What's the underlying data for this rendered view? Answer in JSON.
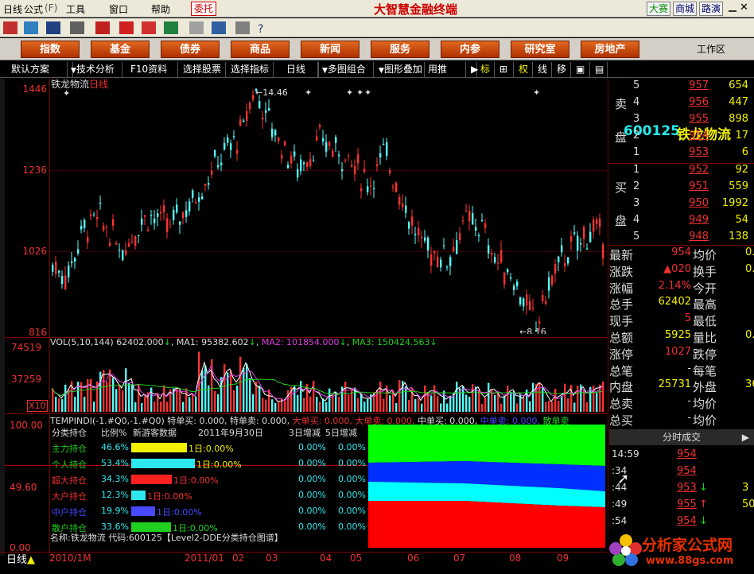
{
  "menu": {
    "items": [
      "日线",
      "公式",
      "工具",
      "窗口",
      "帮助"
    ],
    "weituo": "委托",
    "app_title": "大智慧金融终端",
    "right_btns": [
      "大赛",
      "商城",
      "路演"
    ]
  },
  "categories": [
    "指数",
    "基金",
    "债券",
    "商品",
    "新闻",
    "服务",
    "内参",
    "研究室",
    "房地产"
  ],
  "work_area": "工作区",
  "tabs": [
    "默认方案",
    "技术分析",
    "F10资料",
    "选择股票",
    "选择指标",
    "日线",
    "多图组合",
    "图形叠加",
    "用推",
    "标",
    "权",
    "线",
    "移"
  ],
  "stock": {
    "code": "600125",
    "name": "铁龙物流"
  },
  "chart": {
    "title_name": "铁龙物流",
    "period": "日线",
    "price_ticks": [
      "1446",
      "1236",
      "1026",
      "816"
    ],
    "hi_label": "14.46",
    "lo_label": "8.16"
  },
  "volume": {
    "header_ma0": "VOL(5,10,144)",
    "v0": "62402.000",
    "ma1": "MA1: 95382.602",
    "ma2": "MA2: 101854.000",
    "ma3": "MA3: 150424.563",
    "ticks": [
      "74519",
      "37259"
    ],
    "unit": "X10"
  },
  "indicator": {
    "header": "TEMPINDI(-1.#Q0,-1.#Q0)",
    "te_buy": "特单买: 0.000,",
    "te_sell": "特单卖: 0.000,",
    "big_buy": "大单买: 0.000,",
    "big_sell": "大单卖: 0.000,",
    "mid_buy": "中单买: 0.000,",
    "mid_sell": "中单卖: 0.000,",
    "small_sell": "散单卖",
    "ticks": [
      "100.00",
      "49.60",
      "0.00"
    ]
  },
  "dde": {
    "headers": [
      "分类持仓",
      "比例%",
      "新游客数据",
      "2011年9月30日",
      "3日增减",
      "5日增减"
    ],
    "rows": [
      {
        "name": "主力持仓",
        "pct": "46.6%",
        "bar": "1日:0.00%",
        "d3": "0.00%",
        "d5": "0.00%",
        "color": "#f2f200",
        "frac": 0.466
      },
      {
        "name": "个人持仓",
        "pct": "53.4%",
        "bar": "1日:0.00%",
        "d3": "0.00%",
        "d5": "0.00%",
        "color": "#2ee8ee",
        "frac": 0.534
      },
      {
        "name": "超大持仓",
        "pct": "34.3%",
        "bar": "1日:0.00%",
        "d3": "0.00%",
        "d5": "0.00%",
        "color": "#ff2020",
        "frac": 0.343
      },
      {
        "name": "大户持仓",
        "pct": "12.3%",
        "bar": "1日:0.00%",
        "d3": "0.00%",
        "d5": "0.00%",
        "color": "#2ee8ee",
        "frac": 0.123
      },
      {
        "name": "中户持仓",
        "pct": "19.9%",
        "bar": "1日:0.00%",
        "d3": "0.00%",
        "d5": "0.00%",
        "color": "#4848ff",
        "frac": 0.199
      },
      {
        "name": "散户持仓",
        "pct": "33.6%",
        "bar": "1日:0.00%",
        "d3": "0.00%",
        "d5": "0.00%",
        "color": "#20d020",
        "frac": 0.336
      }
    ],
    "footer": "名称:铁龙物流 代码:600125【Level2-DDE分类持仓图谱】"
  },
  "dates": [
    "2010/1M",
    "2011/01",
    "02",
    "03",
    "04",
    "05",
    "06",
    "07",
    "08",
    "09"
  ],
  "day_label": "日线",
  "orderbook": {
    "sell_label": [
      "卖",
      "盘"
    ],
    "buy_label": [
      "买",
      "盘"
    ],
    "sells": [
      {
        "i": "5",
        "p": "957",
        "v": "654"
      },
      {
        "i": "4",
        "p": "956",
        "v": "447"
      },
      {
        "i": "3",
        "p": "955",
        "v": "898"
      },
      {
        "i": "2",
        "p": "954",
        "v": "17"
      },
      {
        "i": "1",
        "p": "953",
        "v": "6"
      }
    ],
    "buys": [
      {
        "i": "1",
        "p": "952",
        "v": "92"
      },
      {
        "i": "2",
        "p": "951",
        "v": "559"
      },
      {
        "i": "3",
        "p": "950",
        "v": "1992"
      },
      {
        "i": "4",
        "p": "949",
        "v": "54"
      },
      {
        "i": "5",
        "p": "948",
        "v": "138"
      }
    ]
  },
  "stats": [
    {
      "l": "最新",
      "v": "954",
      "l2": "均价",
      "v2": "0."
    },
    {
      "l": "涨跌",
      "v": "▲020",
      "l2": "换手",
      "v2": "0."
    },
    {
      "l": "涨幅",
      "v": "2.14%",
      "l2": "今开",
      "v2": ""
    },
    {
      "l": "总手",
      "v": "62402",
      "l2": "最高",
      "v2": ""
    },
    {
      "l": "现手",
      "v": "5",
      "l2": "最低",
      "v2": ""
    },
    {
      "l": "总额",
      "v": "5925",
      "l2": "量比",
      "v2": "0."
    },
    {
      "l": "涨停",
      "v": "1027",
      "l2": "跌停",
      "v2": ""
    },
    {
      "l": "总笔",
      "v": "-",
      "l2": "每笔",
      "v2": ""
    },
    {
      "l": "内盘",
      "v": "25731",
      "l2": "外盘",
      "v2": "36"
    },
    {
      "l": "总卖",
      "v": "-",
      "l2": "均价",
      "v2": ""
    },
    {
      "l": "总买",
      "v": "-",
      "l2": "均价",
      "v2": ""
    }
  ],
  "ticks_btn": "分时成交",
  "trades": [
    {
      "t": "14:59",
      "p": "954",
      "dir": "",
      "q": ""
    },
    {
      "t": ":34",
      "p": "954",
      "dir": "",
      "q": ""
    },
    {
      "t": ":44",
      "p": "953",
      "dir": "↓",
      "q": "3"
    },
    {
      "t": ":49",
      "p": "955",
      "dir": "↑",
      "q": "50"
    },
    {
      "t": ":54",
      "p": "954",
      "dir": "↓",
      "q": ""
    }
  ],
  "watermark": {
    "text": "分析家公式网",
    "url": "www.88gs.com"
  }
}
